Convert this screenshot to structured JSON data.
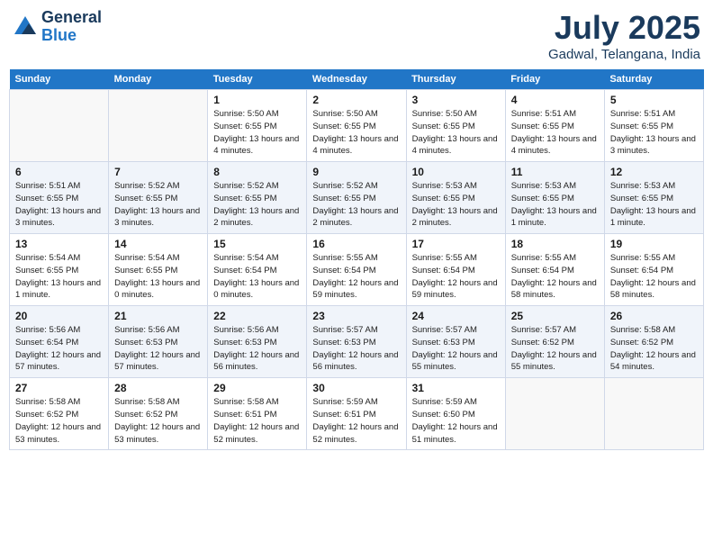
{
  "header": {
    "logo_line1": "General",
    "logo_line2": "Blue",
    "month_year": "July 2025",
    "location": "Gadwal, Telangana, India"
  },
  "days_of_week": [
    "Sunday",
    "Monday",
    "Tuesday",
    "Wednesday",
    "Thursday",
    "Friday",
    "Saturday"
  ],
  "weeks": [
    [
      {
        "day": "",
        "info": ""
      },
      {
        "day": "",
        "info": ""
      },
      {
        "day": "1",
        "info": "Sunrise: 5:50 AM\nSunset: 6:55 PM\nDaylight: 13 hours and 4 minutes."
      },
      {
        "day": "2",
        "info": "Sunrise: 5:50 AM\nSunset: 6:55 PM\nDaylight: 13 hours and 4 minutes."
      },
      {
        "day": "3",
        "info": "Sunrise: 5:50 AM\nSunset: 6:55 PM\nDaylight: 13 hours and 4 minutes."
      },
      {
        "day": "4",
        "info": "Sunrise: 5:51 AM\nSunset: 6:55 PM\nDaylight: 13 hours and 4 minutes."
      },
      {
        "day": "5",
        "info": "Sunrise: 5:51 AM\nSunset: 6:55 PM\nDaylight: 13 hours and 3 minutes."
      }
    ],
    [
      {
        "day": "6",
        "info": "Sunrise: 5:51 AM\nSunset: 6:55 PM\nDaylight: 13 hours and 3 minutes."
      },
      {
        "day": "7",
        "info": "Sunrise: 5:52 AM\nSunset: 6:55 PM\nDaylight: 13 hours and 3 minutes."
      },
      {
        "day": "8",
        "info": "Sunrise: 5:52 AM\nSunset: 6:55 PM\nDaylight: 13 hours and 2 minutes."
      },
      {
        "day": "9",
        "info": "Sunrise: 5:52 AM\nSunset: 6:55 PM\nDaylight: 13 hours and 2 minutes."
      },
      {
        "day": "10",
        "info": "Sunrise: 5:53 AM\nSunset: 6:55 PM\nDaylight: 13 hours and 2 minutes."
      },
      {
        "day": "11",
        "info": "Sunrise: 5:53 AM\nSunset: 6:55 PM\nDaylight: 13 hours and 1 minute."
      },
      {
        "day": "12",
        "info": "Sunrise: 5:53 AM\nSunset: 6:55 PM\nDaylight: 13 hours and 1 minute."
      }
    ],
    [
      {
        "day": "13",
        "info": "Sunrise: 5:54 AM\nSunset: 6:55 PM\nDaylight: 13 hours and 1 minute."
      },
      {
        "day": "14",
        "info": "Sunrise: 5:54 AM\nSunset: 6:55 PM\nDaylight: 13 hours and 0 minutes."
      },
      {
        "day": "15",
        "info": "Sunrise: 5:54 AM\nSunset: 6:54 PM\nDaylight: 13 hours and 0 minutes."
      },
      {
        "day": "16",
        "info": "Sunrise: 5:55 AM\nSunset: 6:54 PM\nDaylight: 12 hours and 59 minutes."
      },
      {
        "day": "17",
        "info": "Sunrise: 5:55 AM\nSunset: 6:54 PM\nDaylight: 12 hours and 59 minutes."
      },
      {
        "day": "18",
        "info": "Sunrise: 5:55 AM\nSunset: 6:54 PM\nDaylight: 12 hours and 58 minutes."
      },
      {
        "day": "19",
        "info": "Sunrise: 5:55 AM\nSunset: 6:54 PM\nDaylight: 12 hours and 58 minutes."
      }
    ],
    [
      {
        "day": "20",
        "info": "Sunrise: 5:56 AM\nSunset: 6:54 PM\nDaylight: 12 hours and 57 minutes."
      },
      {
        "day": "21",
        "info": "Sunrise: 5:56 AM\nSunset: 6:53 PM\nDaylight: 12 hours and 57 minutes."
      },
      {
        "day": "22",
        "info": "Sunrise: 5:56 AM\nSunset: 6:53 PM\nDaylight: 12 hours and 56 minutes."
      },
      {
        "day": "23",
        "info": "Sunrise: 5:57 AM\nSunset: 6:53 PM\nDaylight: 12 hours and 56 minutes."
      },
      {
        "day": "24",
        "info": "Sunrise: 5:57 AM\nSunset: 6:53 PM\nDaylight: 12 hours and 55 minutes."
      },
      {
        "day": "25",
        "info": "Sunrise: 5:57 AM\nSunset: 6:52 PM\nDaylight: 12 hours and 55 minutes."
      },
      {
        "day": "26",
        "info": "Sunrise: 5:58 AM\nSunset: 6:52 PM\nDaylight: 12 hours and 54 minutes."
      }
    ],
    [
      {
        "day": "27",
        "info": "Sunrise: 5:58 AM\nSunset: 6:52 PM\nDaylight: 12 hours and 53 minutes."
      },
      {
        "day": "28",
        "info": "Sunrise: 5:58 AM\nSunset: 6:52 PM\nDaylight: 12 hours and 53 minutes."
      },
      {
        "day": "29",
        "info": "Sunrise: 5:58 AM\nSunset: 6:51 PM\nDaylight: 12 hours and 52 minutes."
      },
      {
        "day": "30",
        "info": "Sunrise: 5:59 AM\nSunset: 6:51 PM\nDaylight: 12 hours and 52 minutes."
      },
      {
        "day": "31",
        "info": "Sunrise: 5:59 AM\nSunset: 6:50 PM\nDaylight: 12 hours and 51 minutes."
      },
      {
        "day": "",
        "info": ""
      },
      {
        "day": "",
        "info": ""
      }
    ]
  ]
}
